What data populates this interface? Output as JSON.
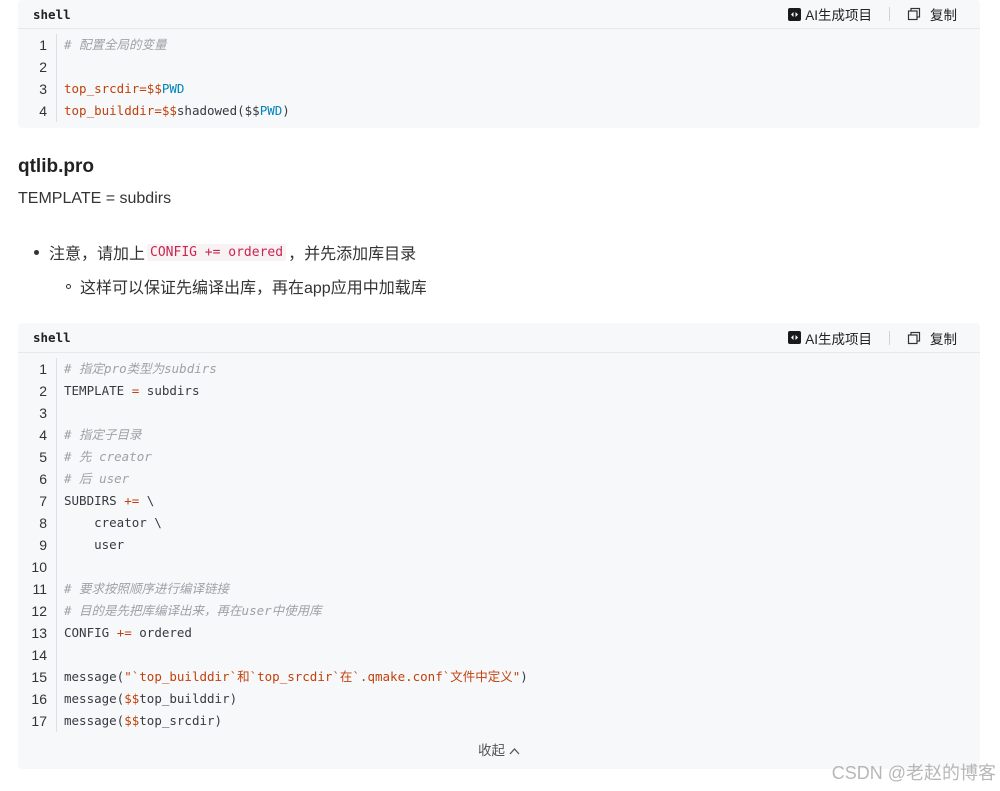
{
  "block1": {
    "lang": "shell",
    "ai_label": "AI生成项目",
    "copy_label": "复制",
    "lines": [
      {
        "n": "1",
        "parts": [
          {
            "t": "# 配置全局的变量",
            "c": "c-com"
          }
        ]
      },
      {
        "n": "2",
        "parts": []
      },
      {
        "n": "3",
        "parts": [
          {
            "t": "top_srcdir",
            "c": "c-red"
          },
          {
            "t": "=",
            "c": "c-red"
          },
          {
            "t": "$$",
            "c": "c-red"
          },
          {
            "t": "PWD",
            "c": "c-op"
          }
        ]
      },
      {
        "n": "4",
        "parts": [
          {
            "t": "top_builddir",
            "c": "c-red"
          },
          {
            "t": "=",
            "c": "c-red"
          },
          {
            "t": "$$",
            "c": "c-red"
          },
          {
            "t": "shadowed(",
            "c": ""
          },
          {
            "t": "$$",
            "c": ""
          },
          {
            "t": "PWD",
            "c": "c-op"
          },
          {
            "t": ")",
            "c": ""
          }
        ]
      }
    ]
  },
  "heading": "qtlib.pro",
  "template_line": "TEMPLATE = subdirs",
  "bullet1": {
    "before": "注意，请加上",
    "code": "CONFIG += ordered",
    "after": "，并先添加库目录"
  },
  "bullet2": "这样可以保证先编译出库，再在app应用中加载库",
  "block2": {
    "lang": "shell",
    "ai_label": "AI生成项目",
    "copy_label": "复制",
    "collapse_label": "收起",
    "lines": [
      {
        "n": "1",
        "parts": [
          {
            "t": "# 指定pro类型为subdirs",
            "c": "c-com"
          }
        ]
      },
      {
        "n": "2",
        "parts": [
          {
            "t": "TEMPLATE ",
            "c": ""
          },
          {
            "t": "=",
            "c": "c-red"
          },
          {
            "t": " subdirs",
            "c": ""
          }
        ]
      },
      {
        "n": "3",
        "parts": []
      },
      {
        "n": "4",
        "parts": [
          {
            "t": "# 指定子目录",
            "c": "c-com"
          }
        ]
      },
      {
        "n": "5",
        "parts": [
          {
            "t": "# 先 creator",
            "c": "c-com"
          }
        ]
      },
      {
        "n": "6",
        "parts": [
          {
            "t": "# 后 user",
            "c": "c-com"
          }
        ]
      },
      {
        "n": "7",
        "parts": [
          {
            "t": "SUBDIRS ",
            "c": ""
          },
          {
            "t": "+=",
            "c": "c-red"
          },
          {
            "t": " \\",
            "c": ""
          }
        ]
      },
      {
        "n": "8",
        "parts": [
          {
            "t": "    creator \\",
            "c": ""
          }
        ]
      },
      {
        "n": "9",
        "parts": [
          {
            "t": "    user",
            "c": ""
          }
        ]
      },
      {
        "n": "10",
        "parts": []
      },
      {
        "n": "11",
        "parts": [
          {
            "t": "# 要求按照顺序进行编译链接",
            "c": "c-com"
          }
        ]
      },
      {
        "n": "12",
        "parts": [
          {
            "t": "# 目的是先把库编译出来，再在user中使用库",
            "c": "c-com"
          }
        ]
      },
      {
        "n": "13",
        "parts": [
          {
            "t": "CONFIG ",
            "c": ""
          },
          {
            "t": "+=",
            "c": "c-red"
          },
          {
            "t": " ordered",
            "c": ""
          }
        ]
      },
      {
        "n": "14",
        "parts": []
      },
      {
        "n": "15",
        "parts": [
          {
            "t": "message(",
            "c": ""
          },
          {
            "t": "\"`top_builddir`和`top_srcdir`在`.qmake.conf`文件中定义\"",
            "c": "c-red"
          },
          {
            "t": ")",
            "c": ""
          }
        ]
      },
      {
        "n": "16",
        "parts": [
          {
            "t": "message(",
            "c": ""
          },
          {
            "t": "$$",
            "c": "c-red"
          },
          {
            "t": "top_builddir)",
            "c": ""
          }
        ]
      },
      {
        "n": "17",
        "parts": [
          {
            "t": "message(",
            "c": ""
          },
          {
            "t": "$$",
            "c": "c-red"
          },
          {
            "t": "top_srcdir)",
            "c": ""
          }
        ]
      }
    ]
  },
  "watermark": "CSDN @老赵的博客"
}
